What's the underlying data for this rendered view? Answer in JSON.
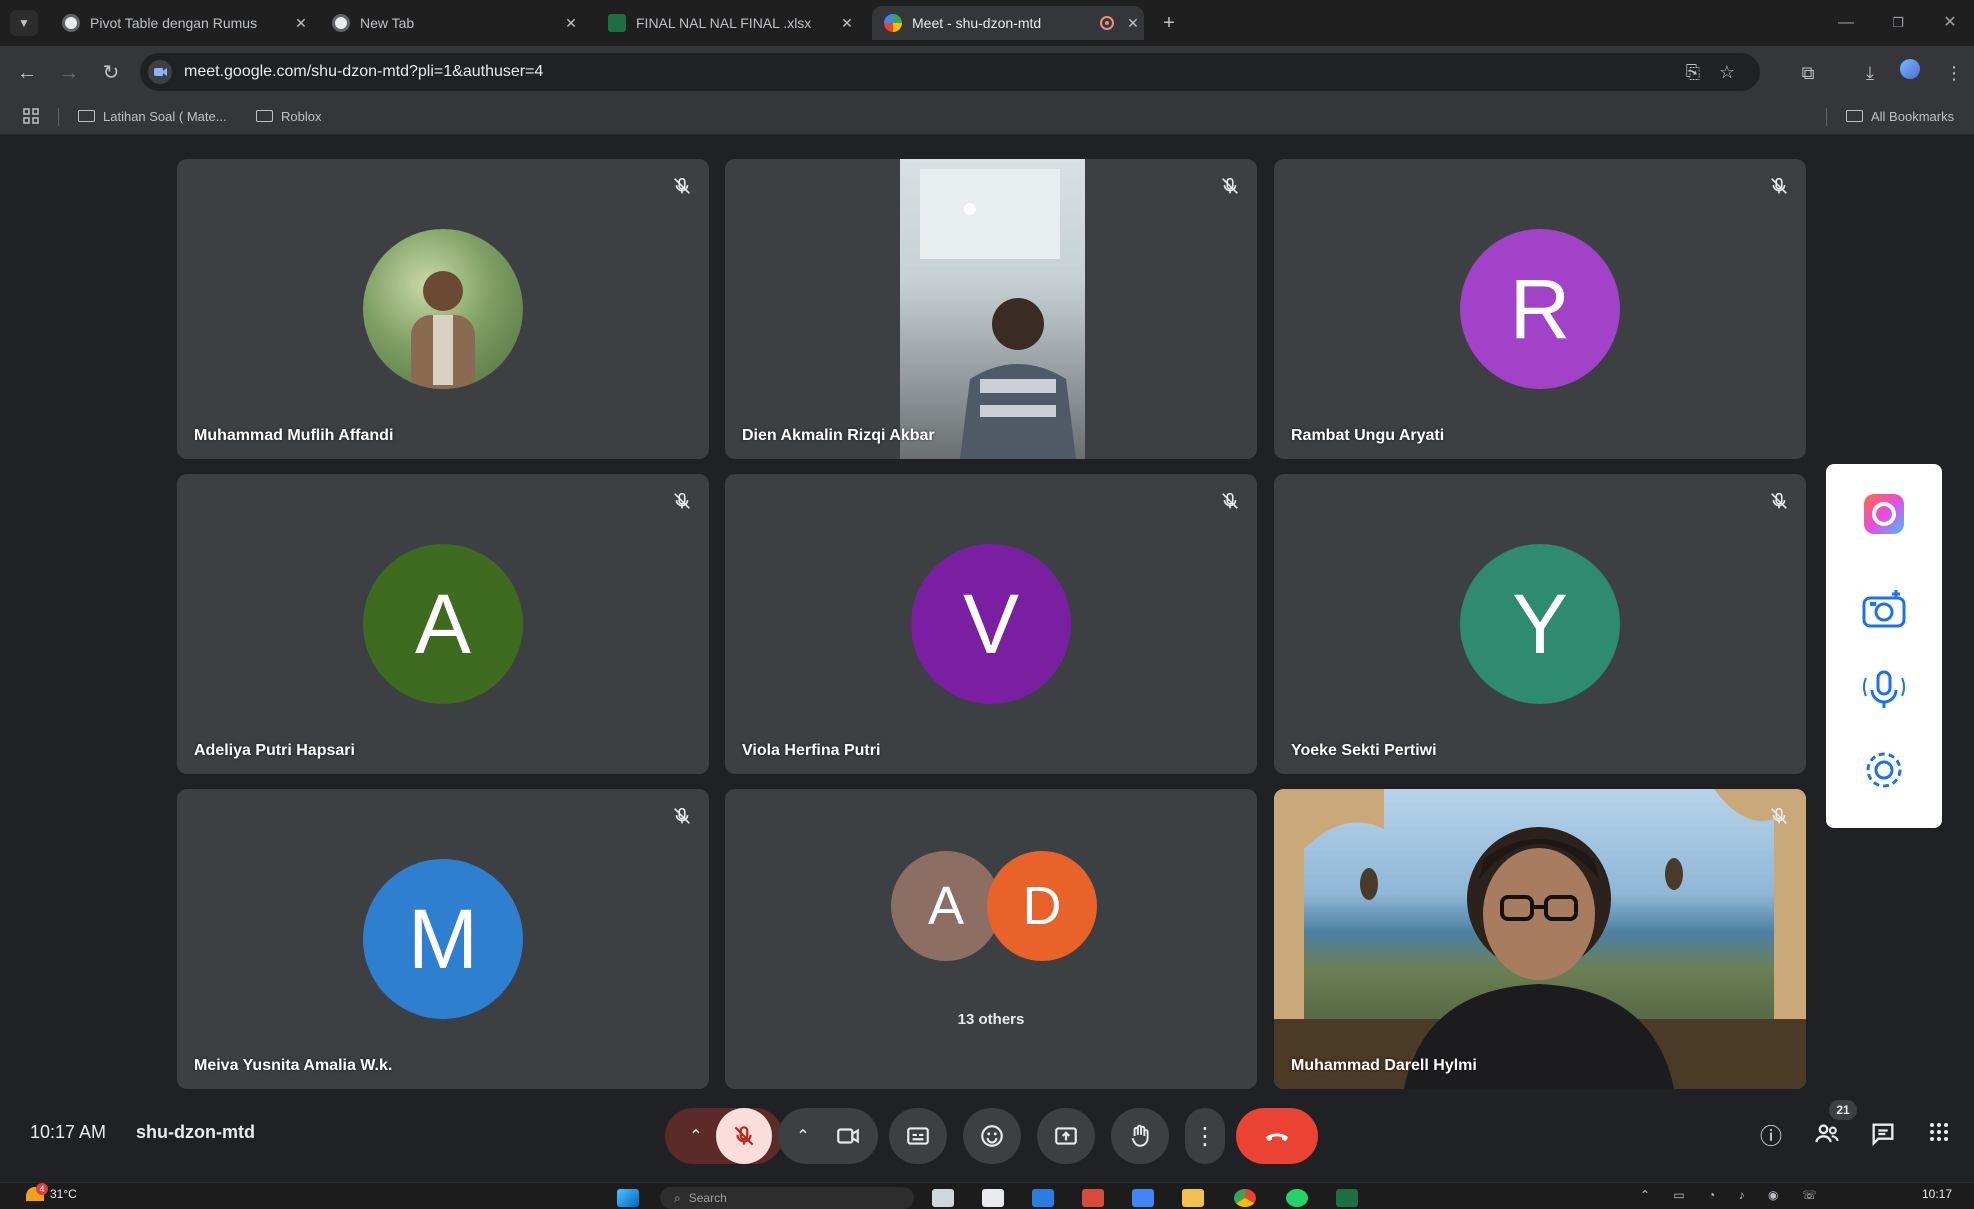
{
  "browser": {
    "tabs": [
      {
        "title": "Pivot Table dengan Rumus",
        "active": false
      },
      {
        "title": "New Tab",
        "active": false
      },
      {
        "title": "FINAL NAL NAL FINAL .xlsx",
        "active": false
      },
      {
        "title": "Meet - shu-dzon-mtd",
        "active": true
      }
    ],
    "url": "meet.google.com/shu-dzon-mtd?pli=1&authuser=4",
    "bookmarks": [
      "Latihan Soal ( Mate...",
      "Roblox"
    ],
    "all_bookmarks": "All Bookmarks"
  },
  "meeting": {
    "time": "10:17 AM",
    "code": "shu-dzon-mtd",
    "participants": [
      {
        "name": "Muhammad Muflih Affandi",
        "type": "photo"
      },
      {
        "name": "Dien Akmalin Rizqi Akbar",
        "type": "video"
      },
      {
        "name": "Rambat Ungu Aryati",
        "type": "letter",
        "letter": "R",
        "color": "#a142c9"
      },
      {
        "name": "Adeliya Putri Hapsari",
        "type": "letter",
        "letter": "A",
        "color": "#3e6b20"
      },
      {
        "name": "Viola Herfina Putri",
        "type": "letter",
        "letter": "V",
        "color": "#7b1fa2"
      },
      {
        "name": "Yoeke Sekti Pertiwi",
        "type": "letter",
        "letter": "Y",
        "color": "#2e8b6f"
      },
      {
        "name": "Meiva Yusnita Amalia W.k.",
        "type": "letter",
        "letter": "M",
        "color": "#2f7fd0"
      },
      {
        "name": "Muhammad Darell Hylmi",
        "type": "video"
      }
    ],
    "others": {
      "label": "13 others",
      "avatars": [
        {
          "letter": "A",
          "color": "#8d6e63"
        },
        {
          "letter": "D",
          "color": "#e8622a"
        }
      ]
    },
    "people_count": "21"
  },
  "taskbar": {
    "weather": "31°C",
    "weather_badge": "4",
    "search_placeholder": "Search",
    "clock": "10:17"
  },
  "colors": {
    "stage_bg": "#202124",
    "tile_bg": "#3c4043",
    "end_call": "#ea4335",
    "mic_off_bg": "#f9dedc"
  }
}
